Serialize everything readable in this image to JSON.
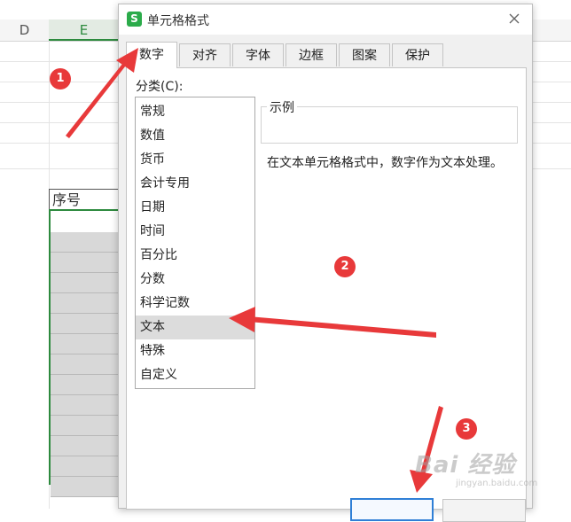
{
  "spreadsheet": {
    "columns": [
      "D",
      "E"
    ],
    "header_cell": "序号",
    "selected_rows": 13
  },
  "dialog": {
    "title": "单元格格式",
    "app_icon": "S",
    "tabs": [
      {
        "label": "数字",
        "active": true
      },
      {
        "label": "对齐",
        "active": false
      },
      {
        "label": "字体",
        "active": false
      },
      {
        "label": "边框",
        "active": false
      },
      {
        "label": "图案",
        "active": false
      },
      {
        "label": "保护",
        "active": false
      }
    ],
    "category_label": "分类(C):",
    "categories": [
      "常规",
      "数值",
      "货币",
      "会计专用",
      "日期",
      "时间",
      "百分比",
      "分数",
      "科学记数",
      "文本",
      "特殊",
      "自定义"
    ],
    "selected_category": "文本",
    "sample_label": "示例",
    "description": "在文本单元格格式中，数字作为文本处理。"
  },
  "annotations": {
    "badges": [
      "1",
      "2",
      "3"
    ],
    "color": "#e8393a"
  },
  "watermark": {
    "main": "Bai 经验",
    "sub": "jingyan.baidu.com"
  },
  "colors": {
    "accent_green": "#2d8a3e",
    "selection_gray": "#d8d8d8",
    "ok_border_blue": "#2f7fd6"
  }
}
